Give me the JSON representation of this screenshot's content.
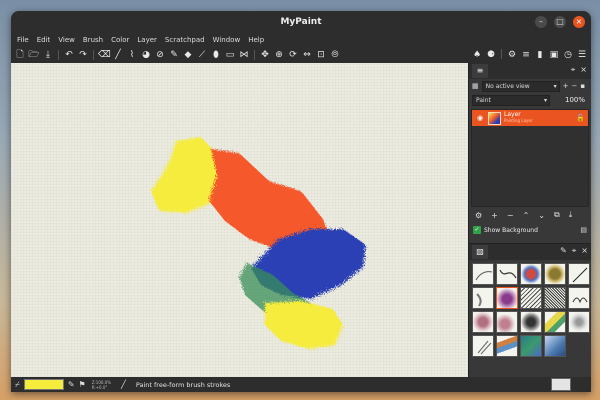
{
  "window": {
    "title": "MyPaint"
  },
  "window_controls": {
    "minimize": "–",
    "maximize": "□",
    "close": "×"
  },
  "menu": [
    "File",
    "Edit",
    "View",
    "Brush",
    "Color",
    "Layer",
    "Scratchpad",
    "Window",
    "Help"
  ],
  "layers_panel": {
    "view_select": "No active view",
    "mode_select": "Paint",
    "opacity": "100%",
    "layer": {
      "name": "Layer",
      "mode": "Painting Layer"
    },
    "show_background_label": "Show Background"
  },
  "statusbar": {
    "color": "#f6ec3c",
    "zoom": "Z:100.0%",
    "angle": "R:+0.0°",
    "message": "Paint free-form brush strokes"
  },
  "colors": {
    "accent": "#e95420",
    "yellow": "#f6ec3c",
    "red": "#f5592c",
    "blue": "#2a3fb4",
    "green": "#3b8f5a"
  }
}
